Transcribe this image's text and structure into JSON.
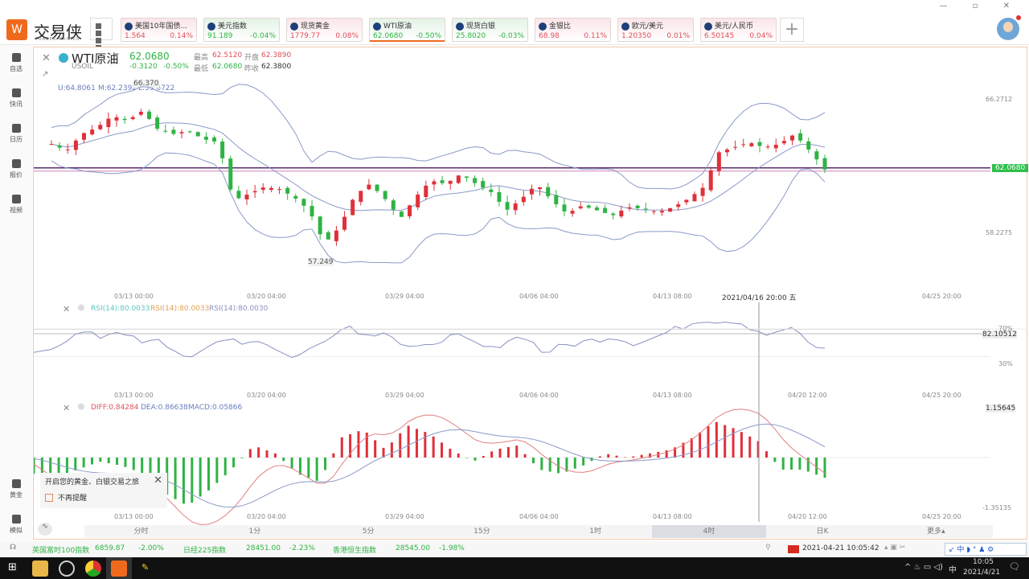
{
  "app": {
    "logo_text": "交易侠",
    "logo_sub": "TRADER MASTER",
    "window_controls": "— ▫ ✕"
  },
  "tickers": [
    {
      "name": "美国10年国债...",
      "price": "1.564",
      "change": "0.14%",
      "trend": "red"
    },
    {
      "name": "美元指数",
      "price": "91.189",
      "change": "-0.04%",
      "trend": "green"
    },
    {
      "name": "现货黄金",
      "price": "1779.77",
      "change": "0.08%",
      "trend": "red"
    },
    {
      "name": "WTI原油",
      "price": "62.0680",
      "change": "-0.50%",
      "trend": "green"
    },
    {
      "name": "现货白银",
      "price": "25.8020",
      "change": "-0.03%",
      "trend": "green"
    },
    {
      "name": "金银比",
      "price": "68.98",
      "change": "0.11%",
      "trend": "red"
    },
    {
      "name": "欧元/美元",
      "price": "1.20350",
      "change": "0.01%",
      "trend": "red"
    },
    {
      "name": "美元/人民币",
      "price": "6.50145",
      "change": "0.04%",
      "trend": "red"
    }
  ],
  "add_label": "+",
  "sidebar": [
    {
      "label": "自选"
    },
    {
      "label": "快讯"
    },
    {
      "label": "日历"
    },
    {
      "label": "报价"
    },
    {
      "label": "视频"
    },
    {
      "label": "黄金"
    },
    {
      "label": "模拟"
    }
  ],
  "quote": {
    "symbol": "WTI原油",
    "code": "USOIL",
    "price": "62.0680",
    "change": "-0.3120",
    "change_pct": "-0.50%",
    "high_label": "最高",
    "high": "62.5120",
    "open_label": "开盘",
    "open": "62.3890",
    "low_label": "最低",
    "low": "62.0680",
    "prev_label": "昨收",
    "prev": "62.3800"
  },
  "boll": {
    "upper": "U:64.8061",
    "mid": "M:62.2392",
    "lower": "L:59.6722"
  },
  "price_labels": {
    "max": "66.370",
    "min": "57.249",
    "axis_top": "66.2712",
    "axis_bottom": "58.2275",
    "current": "62.0680"
  },
  "time_axis": [
    "03/13 00:00",
    "03/20 04:00",
    "03/29 04:00",
    "04/06 04:00",
    "04/13 08:00",
    "04/20 12:00",
    "04/25 20:00"
  ],
  "crosshair_time": "2021/04/16 20:00 五",
  "rsi": {
    "legend": [
      "RSI(14):80.0033",
      "RSI(14):80.0033",
      "RSI(14):80.0030"
    ],
    "level_70": "70%",
    "level_30": "30%",
    "value": "82.10512"
  },
  "macd": {
    "diff": "DIFF:0.84284",
    "dea": "DEA:0.86638",
    "macd": "MACD:0.05866",
    "value": "1.15645",
    "min": "-1.35135"
  },
  "popup": {
    "text": "开启您的黄金、白银交易之旅",
    "checkbox": "不再提醒"
  },
  "periods": [
    {
      "label": "分时"
    },
    {
      "label": "1分"
    },
    {
      "label": "5分"
    },
    {
      "label": "15分"
    },
    {
      "label": "1时"
    },
    {
      "label": "4时",
      "active": true
    },
    {
      "label": "日K"
    },
    {
      "label": "更多▴"
    }
  ],
  "status": {
    "items": [
      {
        "name": "英国富时100指数",
        "value": "6859.87",
        "change": "-2.00%"
      },
      {
        "name": "日经225指数",
        "value": "28451.00",
        "change": "-2.23%"
      },
      {
        "name": "香港恒生指数",
        "value": "28545.00",
        "change": "-1.98%"
      }
    ],
    "datetime": "2021-04-21 10:05:42"
  },
  "taskbar": {
    "time": "10:05",
    "date": "2021/4/21",
    "ime": "中"
  },
  "chart_data": {
    "type": "candlestick",
    "price_keypoints": [
      63.6,
      63.2,
      64.2,
      64.6,
      65.3,
      65.0,
      65.6,
      64.5,
      64.2,
      64.4,
      63.9,
      63.7,
      60.2,
      60.6,
      61.0,
      60.9,
      60.4,
      59.6,
      57.6,
      58.6,
      60.5,
      61.2,
      60.3,
      59.1,
      60.4,
      61.4,
      61.2,
      61.8,
      61.2,
      60.7,
      59.6,
      60.3,
      61.2,
      60.2,
      59.4,
      59.9,
      59.6,
      59.3,
      59.8,
      59.7,
      59.5,
      59.8,
      60.3,
      61.0,
      63.1,
      63.4,
      63.7,
      63.4,
      63.6,
      64.2,
      63.2,
      62.07
    ],
    "rsi_keypoints": [
      35,
      45,
      55,
      65,
      55,
      70,
      50,
      60,
      40,
      25,
      45,
      60,
      50,
      55,
      35,
      30,
      45,
      65,
      75,
      60,
      70,
      45,
      40,
      55,
      60,
      50,
      40,
      55,
      60,
      35,
      45,
      50,
      55,
      60,
      50,
      55,
      65,
      75,
      85,
      82,
      83,
      70,
      60,
      75,
      50,
      40
    ],
    "macd_hist_keypoints": [
      -0.4,
      -0.5,
      -0.3,
      -0.1,
      -0.2,
      -0.4,
      -0.9,
      -1.2,
      -0.8,
      -0.3,
      0.3,
      0.1,
      -0.4,
      -0.6,
      0.5,
      0.7,
      0.2,
      0.8,
      0.6,
      0.2,
      -0.1,
      0.2,
      0.3,
      -0.3,
      -0.4,
      -0.2,
      0.1,
      0.0,
      0.1,
      0.2,
      0.5,
      0.9,
      0.7,
      0.4,
      -0.3,
      -0.3,
      -0.5
    ]
  }
}
